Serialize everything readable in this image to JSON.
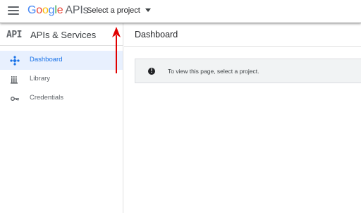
{
  "topbar": {
    "logo_google": "Google",
    "logo_apis": "APIs",
    "project_select_label": "Select a project",
    "colors": {
      "g_blue": "#4285f4",
      "g_red": "#ea4335",
      "g_yellow": "#fbbc05",
      "g_green": "#34a853"
    }
  },
  "sidebar": {
    "badge": "API",
    "title": "APIs & Services",
    "items": [
      {
        "label": "Dashboard",
        "icon": "dashboard-icon",
        "active": true
      },
      {
        "label": "Library",
        "icon": "library-icon",
        "active": false
      },
      {
        "label": "Credentials",
        "icon": "key-icon",
        "active": false
      }
    ]
  },
  "main": {
    "title": "Dashboard",
    "info_message": "To view this page, select a project.",
    "info_icon": "info-icon"
  },
  "annotation": {
    "type": "arrow-up",
    "color": "#e00000"
  }
}
